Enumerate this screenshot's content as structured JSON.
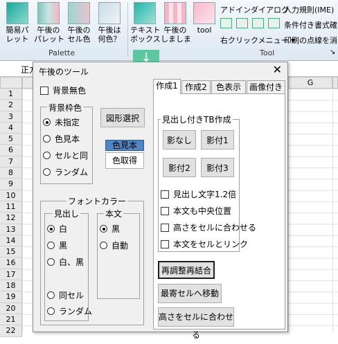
{
  "ribbon": {
    "buttons": [
      {
        "label": "簡易パ\nレット"
      },
      {
        "label": "午後の\nパレット"
      },
      {
        "label": "午後の\nセル色"
      },
      {
        "label": "午後は\n何色？"
      },
      {
        "label": "テキスト\nボックス"
      },
      {
        "label": "午後の\nしましま"
      },
      {
        "label": "tool"
      }
    ],
    "groups": {
      "palette": "Palette",
      "tool": "Tool"
    },
    "menu": {
      "addin_dialog": "アドインダイアログ",
      "input_rule": "入力規則(IME)",
      "conditional_format": "条件付き書式確",
      "right_click_menu": "右クリックメニュー",
      "print_dots": "印刷の点線を消"
    }
  },
  "sheet": {
    "namebox": "正方",
    "columns": [
      "G"
    ],
    "rows": [
      "1",
      "2",
      "3",
      "4",
      "5",
      "6",
      "7",
      "8",
      "9",
      "10",
      "11",
      "12",
      "13",
      "14",
      "15",
      "16",
      "17",
      "18",
      "19",
      "20",
      "21",
      "22"
    ]
  },
  "dialog": {
    "title": "午後のツール",
    "close": "✕",
    "no_background": "背景無色",
    "bg_frame": {
      "title": "背景枠色",
      "options": [
        "未指定",
        "色見本",
        "セルと同",
        "ランダム"
      ],
      "selected": 0
    },
    "shape_select": "図形選択",
    "color_sample": "色見本",
    "color_pick": "色取得",
    "font_color": {
      "title": "フォントカラー",
      "heading": {
        "title": "見出し",
        "options": [
          "白",
          "黒",
          "白、黒",
          "同セル",
          "ランダム"
        ],
        "selected": 0
      },
      "body": {
        "title": "本文",
        "options": [
          "黒",
          "自動"
        ],
        "selected": 0
      }
    },
    "tabs": [
      "作成1",
      "作成2",
      "色表示",
      "画像付き"
    ],
    "tb_frame": {
      "title": "見出し付きTB作成",
      "buttons": [
        "影なし",
        "影付1",
        "影付2",
        "影付3"
      ],
      "checks": [
        "見出し文字1.2倍",
        "本文も中央位置",
        "高さをセルに合わせる",
        "本文をセルとリンク"
      ]
    },
    "actions": [
      "再調整再結合",
      "最寄セルへ移動",
      "高さをセルに合わせる"
    ]
  }
}
